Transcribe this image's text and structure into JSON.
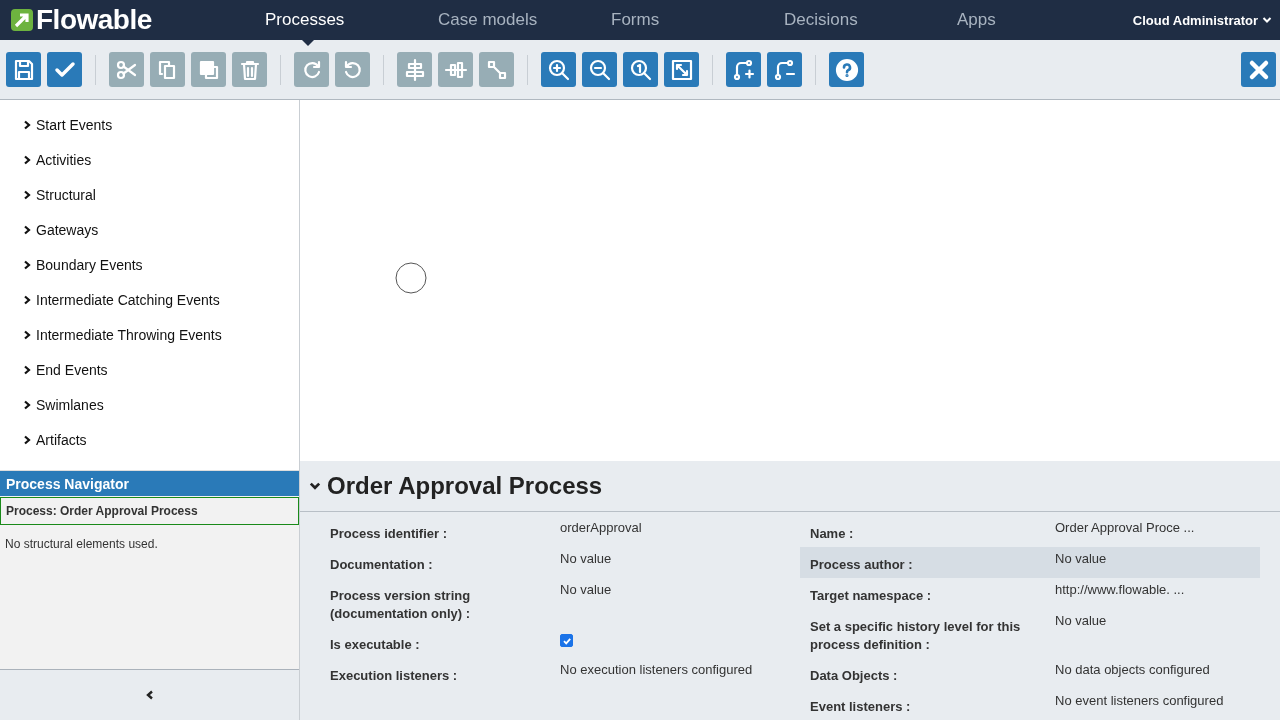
{
  "logo": {
    "text": "Flowable"
  },
  "nav": [
    {
      "label": "Processes",
      "selected": true
    },
    {
      "label": "Case models",
      "selected": false
    },
    {
      "label": "Forms",
      "selected": false
    },
    {
      "label": "Decisions",
      "selected": false
    },
    {
      "label": "Apps",
      "selected": false
    }
  ],
  "user": {
    "label": "Cloud Administrator"
  },
  "toolbar": [
    [
      {
        "kind": "save",
        "disabled": false
      },
      {
        "kind": "validate",
        "disabled": false
      }
    ],
    [
      {
        "kind": "cut",
        "disabled": true
      },
      {
        "kind": "copy",
        "disabled": true
      },
      {
        "kind": "paste",
        "disabled": true
      },
      {
        "kind": "delete",
        "disabled": true
      }
    ],
    [
      {
        "kind": "redo",
        "disabled": true
      },
      {
        "kind": "undo",
        "disabled": true
      }
    ],
    [
      {
        "kind": "align-h",
        "disabled": true
      },
      {
        "kind": "align-v",
        "disabled": true
      },
      {
        "kind": "same-size",
        "disabled": true
      }
    ],
    [
      {
        "kind": "zoom-in",
        "disabled": false
      },
      {
        "kind": "zoom-out",
        "disabled": false
      },
      {
        "kind": "zoom-actual",
        "disabled": false
      },
      {
        "kind": "zoom-fit",
        "disabled": false
      }
    ],
    [
      {
        "kind": "bend-add",
        "disabled": false
      },
      {
        "kind": "bend-remove",
        "disabled": false
      }
    ],
    [
      {
        "kind": "help",
        "disabled": false
      }
    ]
  ],
  "palette": [
    "Start Events",
    "Activities",
    "Structural",
    "Gateways",
    "Boundary Events",
    "Intermediate Catching Events",
    "Intermediate Throwing Events",
    "End Events",
    "Swimlanes",
    "Artifacts"
  ],
  "navigator": {
    "title": "Process Navigator",
    "process": "Process: Order Approval Process",
    "empty": "No structural elements used."
  },
  "properties": {
    "title": "Order Approval Process",
    "left": [
      {
        "kind": "text",
        "label": "Process identifier :",
        "value": "orderApproval"
      },
      {
        "kind": "text",
        "label": "Documentation :",
        "value": "No value"
      },
      {
        "kind": "text",
        "label": "Process version string (documentation only) :",
        "value": "No value"
      },
      {
        "kind": "checkbox",
        "label": "Is executable :",
        "checked": true
      },
      {
        "kind": "text",
        "label": "Execution listeners :",
        "value": "No execution listeners configured"
      }
    ],
    "right": [
      {
        "kind": "text",
        "label": "Name :",
        "value": "Order Approval Proce ...",
        "selected": false
      },
      {
        "kind": "text",
        "label": "Process author :",
        "value": "No value",
        "selected": true
      },
      {
        "kind": "text",
        "label": "Target namespace :",
        "value": "http://www.flowable. ...",
        "selected": false
      },
      {
        "kind": "text",
        "label": "Set a specific history level for this process definition :",
        "value": "No value",
        "selected": false
      },
      {
        "kind": "text",
        "label": "Data Objects :",
        "value": "No data objects configured",
        "selected": false
      },
      {
        "kind": "text",
        "label": "Event listeners :",
        "value": "No event listeners configured",
        "selected": false
      }
    ]
  }
}
